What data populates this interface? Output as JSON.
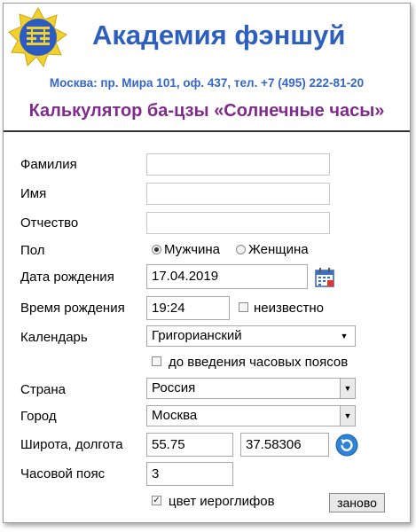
{
  "header": {
    "title": "Академия фэншуй",
    "address": "Москва: пр. Мира 101, оф. 437, тел. +7 (495) 222-81-20",
    "calc_title": "Калькулятор ба-цзы «Солнечные часы»"
  },
  "form": {
    "surname": {
      "label": "Фамилия",
      "value": ""
    },
    "name": {
      "label": "Имя",
      "value": ""
    },
    "patronymic": {
      "label": "Отчество",
      "value": ""
    },
    "gender": {
      "label": "Пол",
      "options": [
        "Мужчина",
        "Женщина"
      ],
      "selected": "Мужчина"
    },
    "birth_date": {
      "label": "Дата рождения",
      "value": "17.04.2019"
    },
    "birth_time": {
      "label": "Время рождения",
      "value": "19:24",
      "unknown_label": "неизвестно",
      "unknown_checked": false
    },
    "calendar": {
      "label": "Календарь",
      "value": "Григорианский"
    },
    "before_tz": {
      "label": "до введения часовых поясов",
      "checked": false
    },
    "country": {
      "label": "Страна",
      "value": "Россия"
    },
    "city": {
      "label": "Город",
      "value": "Москва"
    },
    "coords": {
      "label": "Широта, долгота",
      "lat": "55.75",
      "lon": "37.58306"
    },
    "timezone": {
      "label": "Часовой пояс",
      "value": "3"
    },
    "glyph_color": {
      "label": "цвет иероглифов",
      "checked": true
    },
    "reset_label": "заново"
  },
  "icons": [
    "academy-logo-icon",
    "calendar-icon",
    "refresh-icon",
    "chevron-down-icon"
  ],
  "colors": {
    "title": "#2e5fbf",
    "address": "#3467c7",
    "calc_title": "#7f2a8c",
    "logo_yellow": "#f2d12e",
    "logo_blue": "#2d5bc4"
  }
}
